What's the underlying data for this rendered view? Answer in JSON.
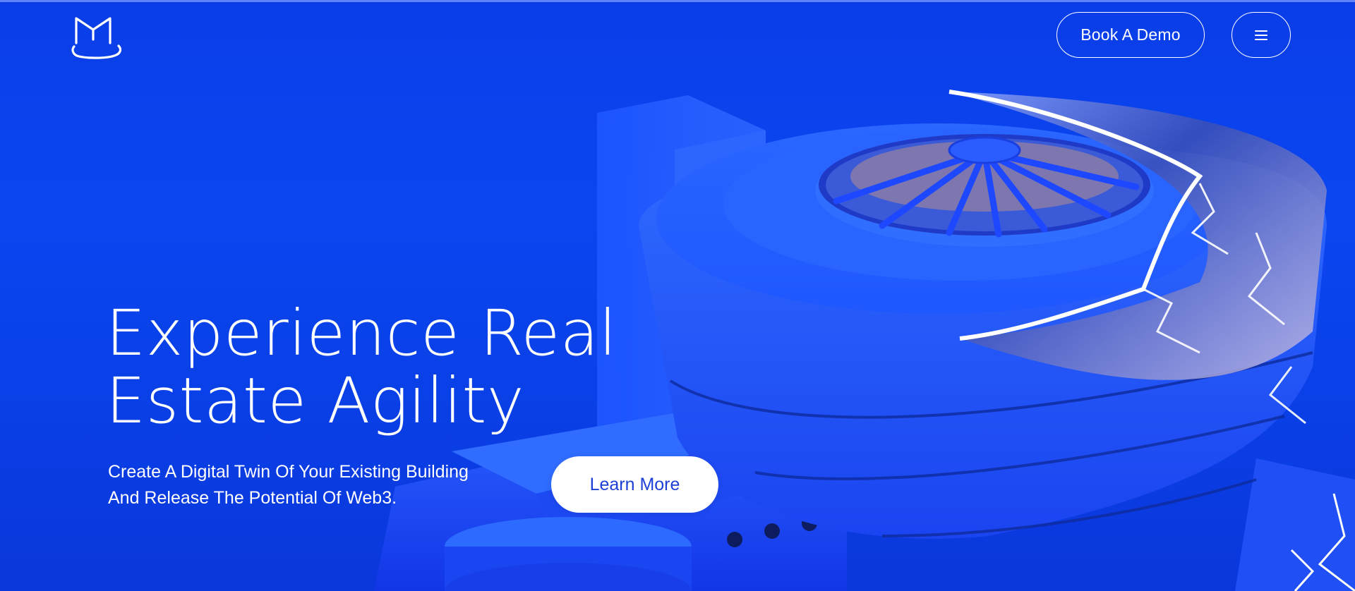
{
  "header": {
    "logo_alt": "M logo",
    "demo_label": "Book A Demo",
    "menu_icon": "hamburger-menu-icon"
  },
  "hero": {
    "title_lines": [
      "Experience Real",
      "Estate Agility"
    ],
    "subtitle_lines": [
      "Create A Digital Twin Of Your Existing Building",
      "And Release The Potential Of Web3."
    ],
    "cta_label": "Learn More"
  },
  "colors": {
    "background": "#0a3fe6",
    "accent_text": "#1d3fd6",
    "foreground": "#ffffff"
  }
}
